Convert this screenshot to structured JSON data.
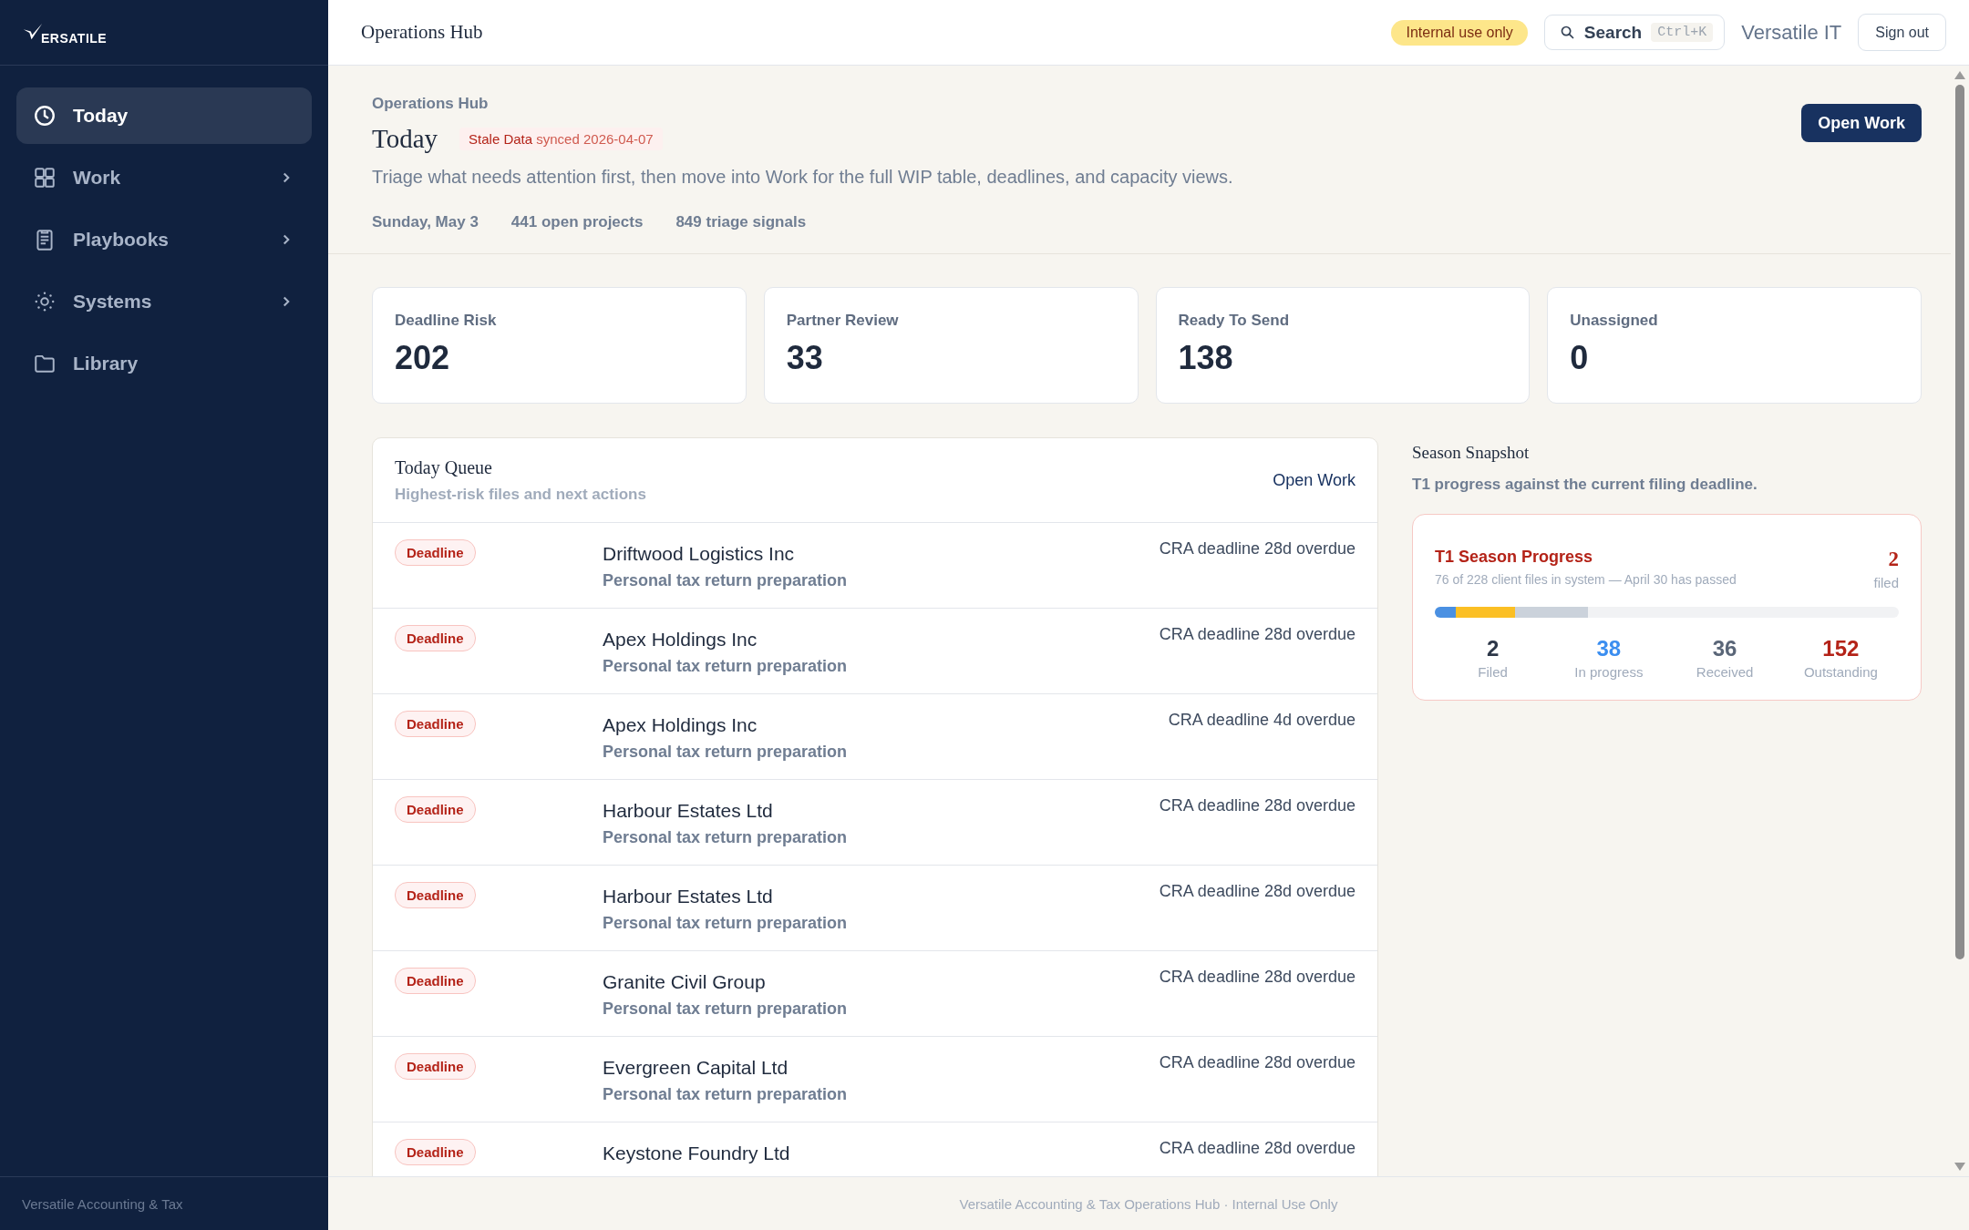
{
  "sidebar": {
    "logo": "ERSATILE",
    "items": [
      {
        "label": "Today",
        "selected": true,
        "expandable": false
      },
      {
        "label": "Work",
        "selected": false,
        "expandable": true
      },
      {
        "label": "Playbooks",
        "selected": false,
        "expandable": true
      },
      {
        "label": "Systems",
        "selected": false,
        "expandable": true
      },
      {
        "label": "Library",
        "selected": false,
        "expandable": false
      }
    ],
    "footer": "Versatile Accounting & Tax"
  },
  "topbar": {
    "title": "Operations Hub",
    "badge": "Internal use only",
    "search": {
      "label": "Search",
      "shortcut": "Ctrl+K"
    },
    "user": "Versatile IT",
    "sign_out": "Sign out"
  },
  "header": {
    "eyebrow": "Operations Hub",
    "title": "Today",
    "stale_badge": {
      "label": "Stale Data",
      "detail": "synced 2026-04-07"
    },
    "description": "Triage what needs attention first, then move into Work for the full WIP table, deadlines, and capacity views.",
    "meta": [
      "Sunday, May 3",
      "441 open projects",
      "849 triage signals"
    ],
    "action": "Open Work"
  },
  "stats": [
    {
      "label": "Deadline Risk",
      "value": "202"
    },
    {
      "label": "Partner Review",
      "value": "33"
    },
    {
      "label": "Ready To Send",
      "value": "138"
    },
    {
      "label": "Unassigned",
      "value": "0"
    }
  ],
  "queue": {
    "title": "Today Queue",
    "subtitle": "Highest-risk files and next actions",
    "link": "Open Work",
    "rows": [
      {
        "badge": "Deadline",
        "client": "Driftwood Logistics Inc",
        "service": "Personal tax return preparation",
        "due": "CRA deadline 28d overdue"
      },
      {
        "badge": "Deadline",
        "client": "Apex Holdings Inc",
        "service": "Personal tax return preparation",
        "due": "CRA deadline 28d overdue"
      },
      {
        "badge": "Deadline",
        "client": "Apex Holdings Inc",
        "service": "Personal tax return preparation",
        "due": "CRA deadline 4d overdue"
      },
      {
        "badge": "Deadline",
        "client": "Harbour Estates Ltd",
        "service": "Personal tax return preparation",
        "due": "CRA deadline 28d overdue"
      },
      {
        "badge": "Deadline",
        "client": "Harbour Estates Ltd",
        "service": "Personal tax return preparation",
        "due": "CRA deadline 28d overdue"
      },
      {
        "badge": "Deadline",
        "client": "Granite Civil Group",
        "service": "Personal tax return preparation",
        "due": "CRA deadline 28d overdue"
      },
      {
        "badge": "Deadline",
        "client": "Evergreen Capital Ltd",
        "service": "Personal tax return preparation",
        "due": "CRA deadline 28d overdue"
      },
      {
        "badge": "Deadline",
        "client": "Keystone Foundry Ltd",
        "due": "CRA deadline 28d overdue"
      }
    ]
  },
  "snapshot": {
    "title": "Season Snapshot",
    "subtitle": "T1 progress against the current filing deadline.",
    "card": {
      "title": "T1 Season Progress",
      "detail": "76 of 228 client files in system — April 30 has passed",
      "count": "2",
      "count_label": "filed",
      "segments": [
        {
          "level": 0.045,
          "color": "#4a90e2"
        },
        {
          "level": 0.128,
          "color": "#fbbf24"
        },
        {
          "level": 0.158,
          "color": "#cbd2db"
        }
      ],
      "figures": [
        {
          "value": "2",
          "label": "Filed",
          "color": "#2d3748"
        },
        {
          "value": "38",
          "label": "In progress",
          "color": "#3b8ef0"
        },
        {
          "value": "36",
          "label": "Received",
          "color": "#5a6678"
        },
        {
          "value": "152",
          "label": "Outstanding",
          "color": "#b42318"
        }
      ]
    }
  },
  "footer": "Versatile Accounting & Tax Operations Hub · Internal Use Only"
}
